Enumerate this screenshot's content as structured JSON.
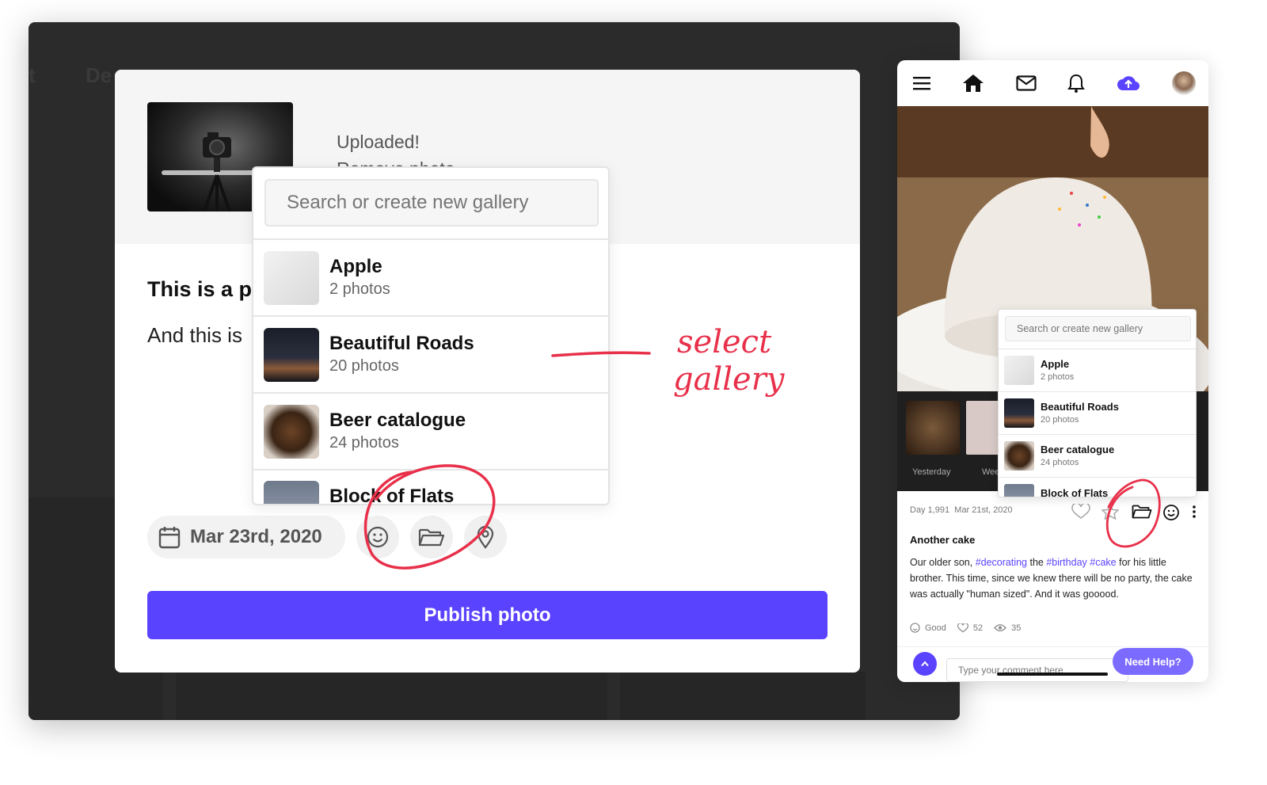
{
  "background_app": {
    "ghost_tabs": [
      "t",
      "De"
    ]
  },
  "upload_modal": {
    "status": "Uploaded!",
    "remove_link": "Remove photo",
    "post_title": "This is a pl",
    "post_body": "And this is",
    "date": "Mar 23rd, 2020",
    "publish_label": "Publish photo"
  },
  "gallery_dropdown": {
    "search_placeholder": "Search or create new gallery",
    "items": [
      {
        "name": "Apple",
        "count": "2 photos"
      },
      {
        "name": "Beautiful Roads",
        "count": "20 photos"
      },
      {
        "name": "Beer catalogue",
        "count": "24 photos"
      },
      {
        "name": "Block of Flats",
        "count": ""
      }
    ]
  },
  "annotation": {
    "line1": "select",
    "line2": "gallery",
    "color": "#e8304a"
  },
  "phone": {
    "strip_labels": [
      "Yesterday",
      "Wee"
    ],
    "meta_day": "Day 1,991",
    "meta_date": "Mar 21st, 2020",
    "post_title": "Another cake",
    "body_pre": "Our older son, ",
    "tag1": "#decorating",
    "body_mid1": " the ",
    "tag2": "#birthday",
    "body_mid2": " ",
    "tag3": "#cake",
    "body_post": " for his little brother. This time, since we knew there will be no party, the cake was actually \"human sized\". And it was gooood.",
    "stat_mood": "Good",
    "stat_likes": "52",
    "stat_views": "35",
    "comment_placeholder": "Type your comment here",
    "help_label": "Need Help?",
    "gallery_dropdown": {
      "search_placeholder": "Search or create new gallery",
      "items": [
        {
          "name": "Apple",
          "count": "2 photos"
        },
        {
          "name": "Beautiful Roads",
          "count": "20 photos"
        },
        {
          "name": "Beer catalogue",
          "count": "24 photos"
        },
        {
          "name": "Block of Flats",
          "count": ""
        }
      ]
    }
  },
  "colors": {
    "accent": "#5a43ff",
    "annotation": "#e8304a",
    "dark_bg": "#2b2b2b"
  }
}
